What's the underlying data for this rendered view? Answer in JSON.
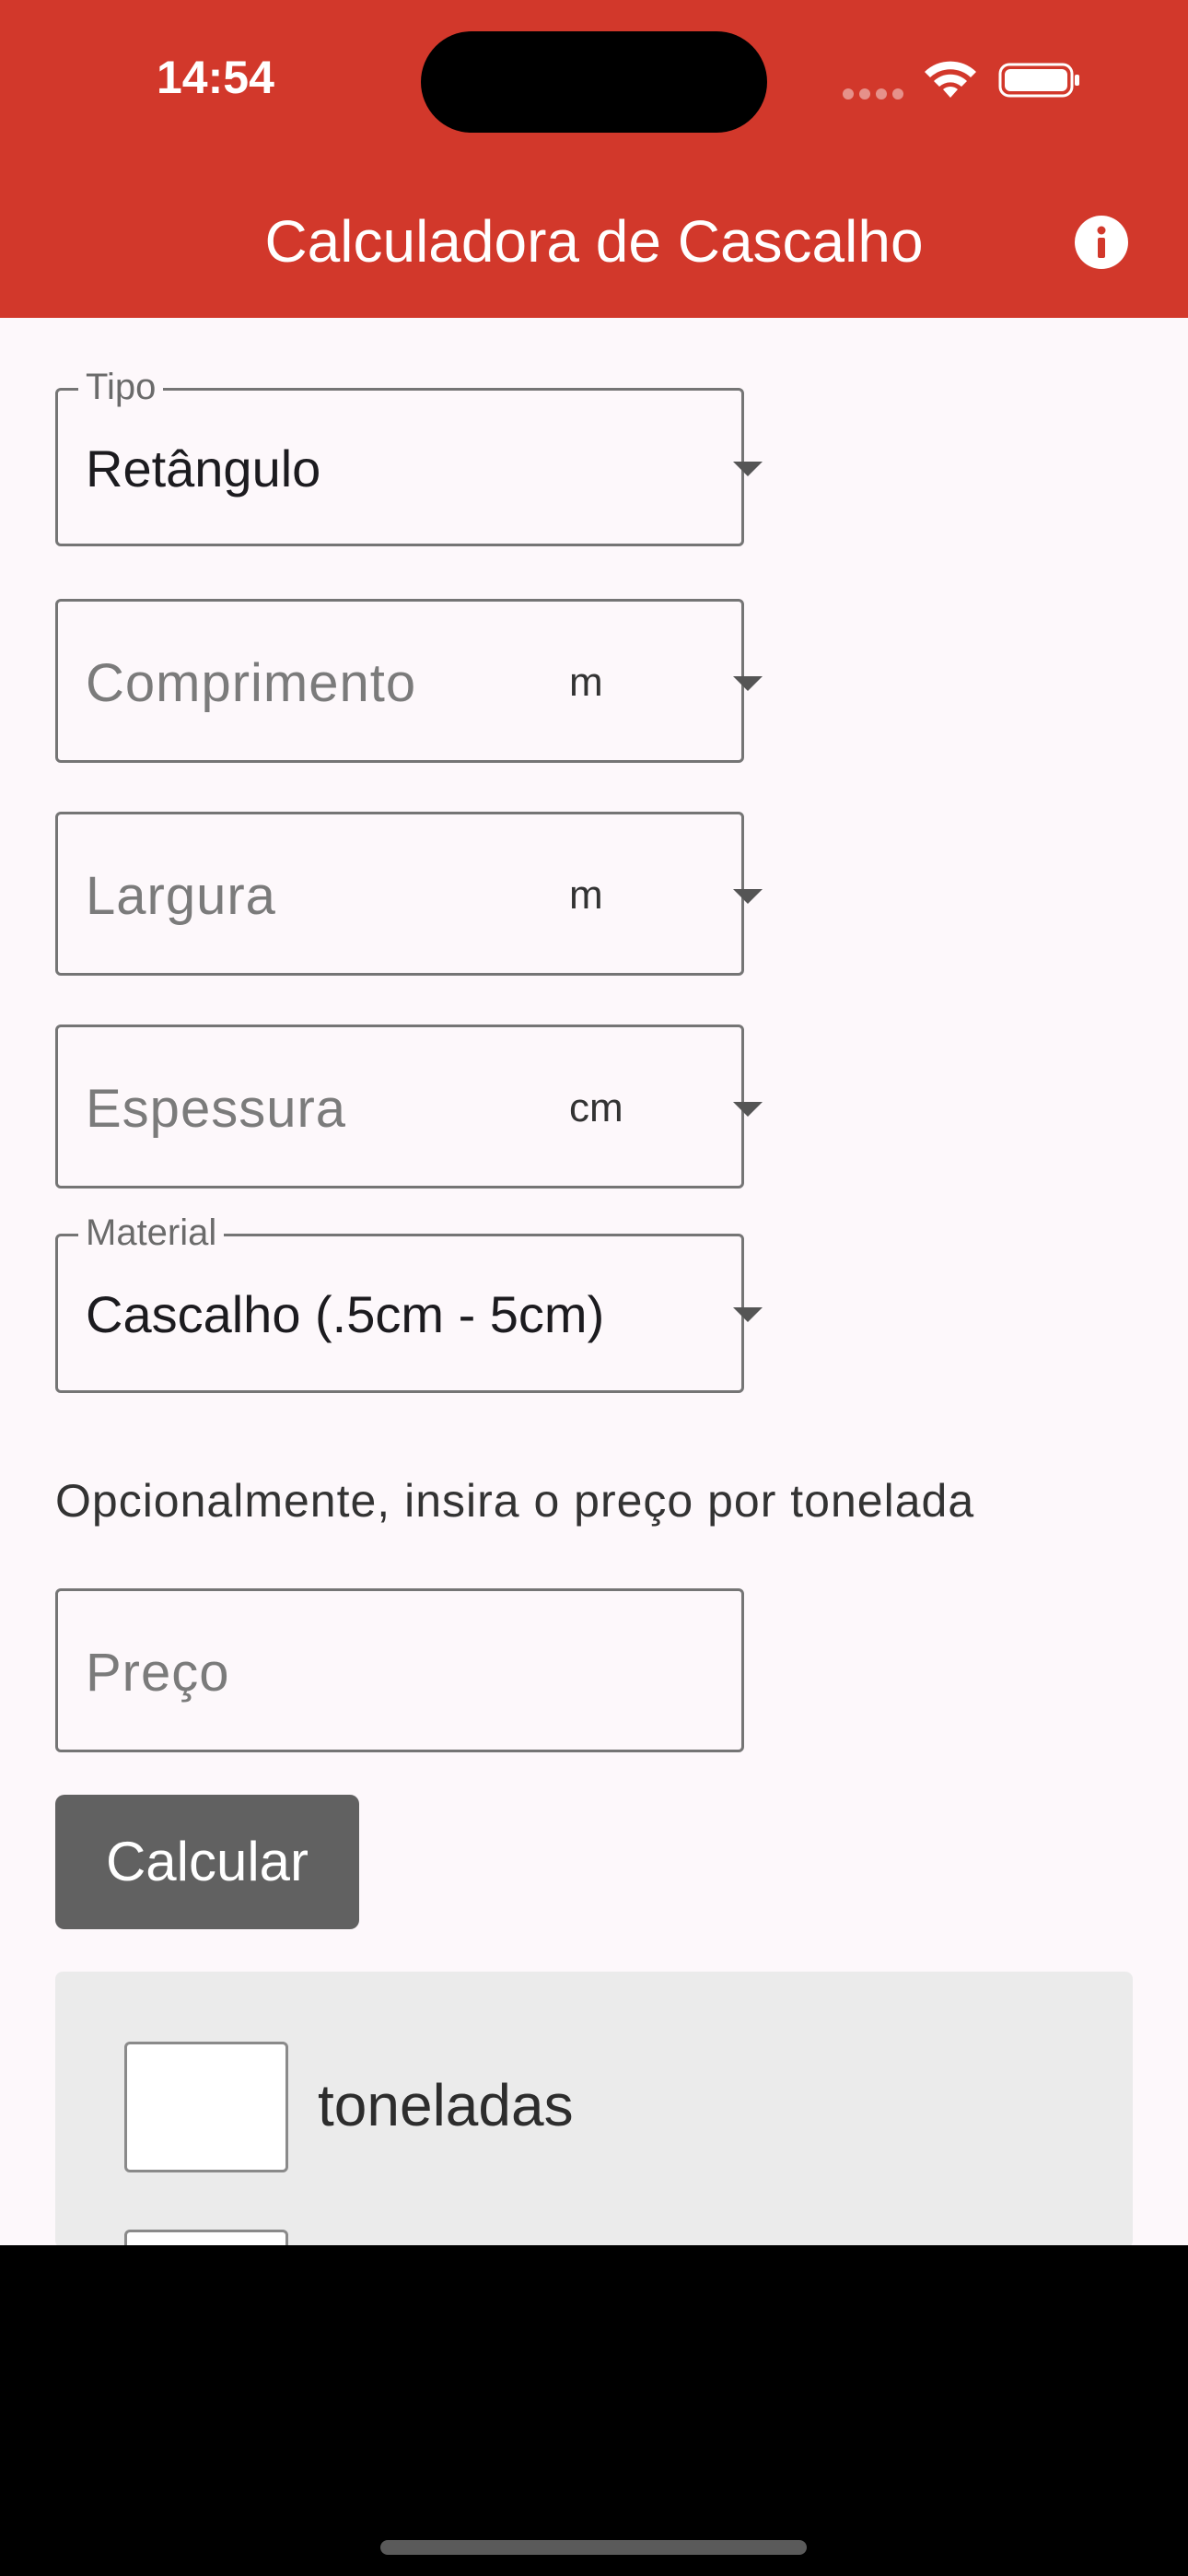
{
  "status_bar": {
    "time": "14:54"
  },
  "app_bar": {
    "title": "Calculadora de Cascalho",
    "info_icon": "info-circle-icon"
  },
  "form": {
    "type": {
      "label": "Tipo",
      "value": "Retângulo"
    },
    "length": {
      "placeholder": "Comprimento",
      "unit": "m"
    },
    "width": {
      "placeholder": "Largura",
      "unit": "m"
    },
    "thickness": {
      "placeholder": "Espessura",
      "unit": "cm"
    },
    "material": {
      "label": "Material",
      "value": "Cascalho (.5cm - 5cm)"
    },
    "price_hint": "Opcionalmente, insira o preço por tonelada",
    "price": {
      "placeholder": "Preço"
    },
    "calculate_label": "Calcular"
  },
  "results": {
    "rows": [
      {
        "value": "",
        "unit": "toneladas"
      }
    ]
  },
  "colors": {
    "primary": "#d2382b",
    "button": "#616161",
    "background": "#fdf8fb"
  }
}
